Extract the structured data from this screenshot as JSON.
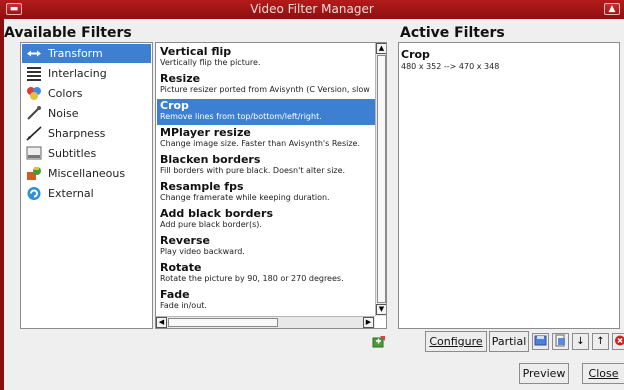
{
  "window": {
    "title": "Video Filter Manager"
  },
  "headings": {
    "available": "Available Filters",
    "active": "Active Filters"
  },
  "categories": [
    {
      "label": "Transform",
      "icon": "transform-icon",
      "selected": true
    },
    {
      "label": "Interlacing",
      "icon": "interlacing-icon",
      "selected": false
    },
    {
      "label": "Colors",
      "icon": "colors-icon",
      "selected": false
    },
    {
      "label": "Noise",
      "icon": "noise-icon",
      "selected": false
    },
    {
      "label": "Sharpness",
      "icon": "sharpness-icon",
      "selected": false
    },
    {
      "label": "Subtitles",
      "icon": "subtitles-icon",
      "selected": false
    },
    {
      "label": "Miscellaneous",
      "icon": "miscellaneous-icon",
      "selected": false
    },
    {
      "label": "External",
      "icon": "external-icon",
      "selected": false
    }
  ],
  "filters": [
    {
      "name": "Vertical flip",
      "desc": "Vertically flip the picture.",
      "selected": false
    },
    {
      "name": "Resize",
      "desc": "Picture resizer ported from Avisynth (C Version, slow",
      "selected": false
    },
    {
      "name": "Crop",
      "desc": "Remove lines from top/bottom/left/right.",
      "selected": true
    },
    {
      "name": "MPlayer resize",
      "desc": "Change image size. Faster than Avisynth's Resize.",
      "selected": false
    },
    {
      "name": "Blacken borders",
      "desc": "Fill borders with pure black. Doesn't alter size.",
      "selected": false
    },
    {
      "name": "Resample fps",
      "desc": "Change framerate while keeping duration.",
      "selected": false
    },
    {
      "name": "Add black borders",
      "desc": "Add pure black border(s).",
      "selected": false
    },
    {
      "name": "Reverse",
      "desc": "Play video backward.",
      "selected": false
    },
    {
      "name": "Rotate",
      "desc": "Rotate the picture by 90, 180 or 270 degrees.",
      "selected": false
    },
    {
      "name": "Fade",
      "desc": "Fade in/out.",
      "selected": false
    }
  ],
  "active_filters": [
    {
      "name": "Crop",
      "desc": "480 x 352 --> 470 x 348"
    }
  ],
  "buttons": {
    "configure": "Configure",
    "partial": "Partial",
    "preview": "Preview",
    "close": "Close"
  },
  "colors": {
    "titlebar": "#a01515",
    "selection": "#3d7fd0"
  }
}
